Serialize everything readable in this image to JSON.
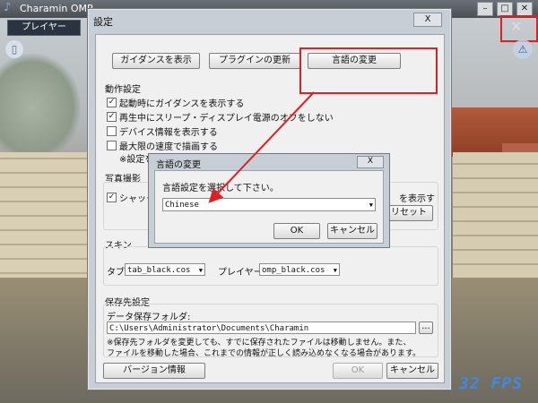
{
  "app": {
    "title": "Charamin OMP",
    "player_tab": "プレイヤー",
    "fps": "32 FPS",
    "window_controls": [
      "minimize-icon",
      "maximize-icon",
      "close-icon"
    ]
  },
  "settings": {
    "title": "設定",
    "close": "X",
    "top_buttons": {
      "guidance": "ガイダンスを表示",
      "update": "プラグインの更新",
      "language": "言語の変更"
    },
    "behavior": {
      "header": "動作設定",
      "items": [
        {
          "label": "起動時にガイダンスを表示する",
          "checked": true
        },
        {
          "label": "再生中にスリープ・ディスプレイ電源のオフをしない",
          "checked": true
        },
        {
          "label": "デバイス情報を表示する",
          "checked": false
        },
        {
          "label": "最大限の速度で描画する",
          "checked": false
        }
      ],
      "note": "※設定を"
    },
    "photo": {
      "header": "写真撮影",
      "checkbox": "シャッタ",
      "checked": true,
      "right_text": "を表示す",
      "reset": "リセット"
    },
    "skin": {
      "header": "スキン",
      "tab_label": "タブ",
      "tab_value": "tab_black.cos",
      "player_label": "プレイヤー",
      "player_value": "omp_black.cos"
    },
    "save": {
      "header": "保存先設定",
      "folder_label": "データ保存フォルダ:",
      "path": "C:\\Users\\Administrator\\Documents\\Charamin",
      "browse": "...",
      "note1": "※保存先フォルダを変更しても、すでに保存されたファイルは移動しません。また、",
      "note2": "ファイルを移動した場合、これまでの情報が正しく読み込めなくなる場合があります。"
    },
    "bottom": {
      "version": "バージョン情報",
      "ok": "OK",
      "cancel": "キャンセル"
    }
  },
  "language_dialog": {
    "title": "言語の変更",
    "close": "X",
    "prompt": "言語設定を選択して下さい。",
    "selected": "Chinese",
    "ok": "OK",
    "cancel": "キャンセル"
  },
  "colors": {
    "highlight": "#e02020",
    "fps": "#3b8ae6"
  }
}
